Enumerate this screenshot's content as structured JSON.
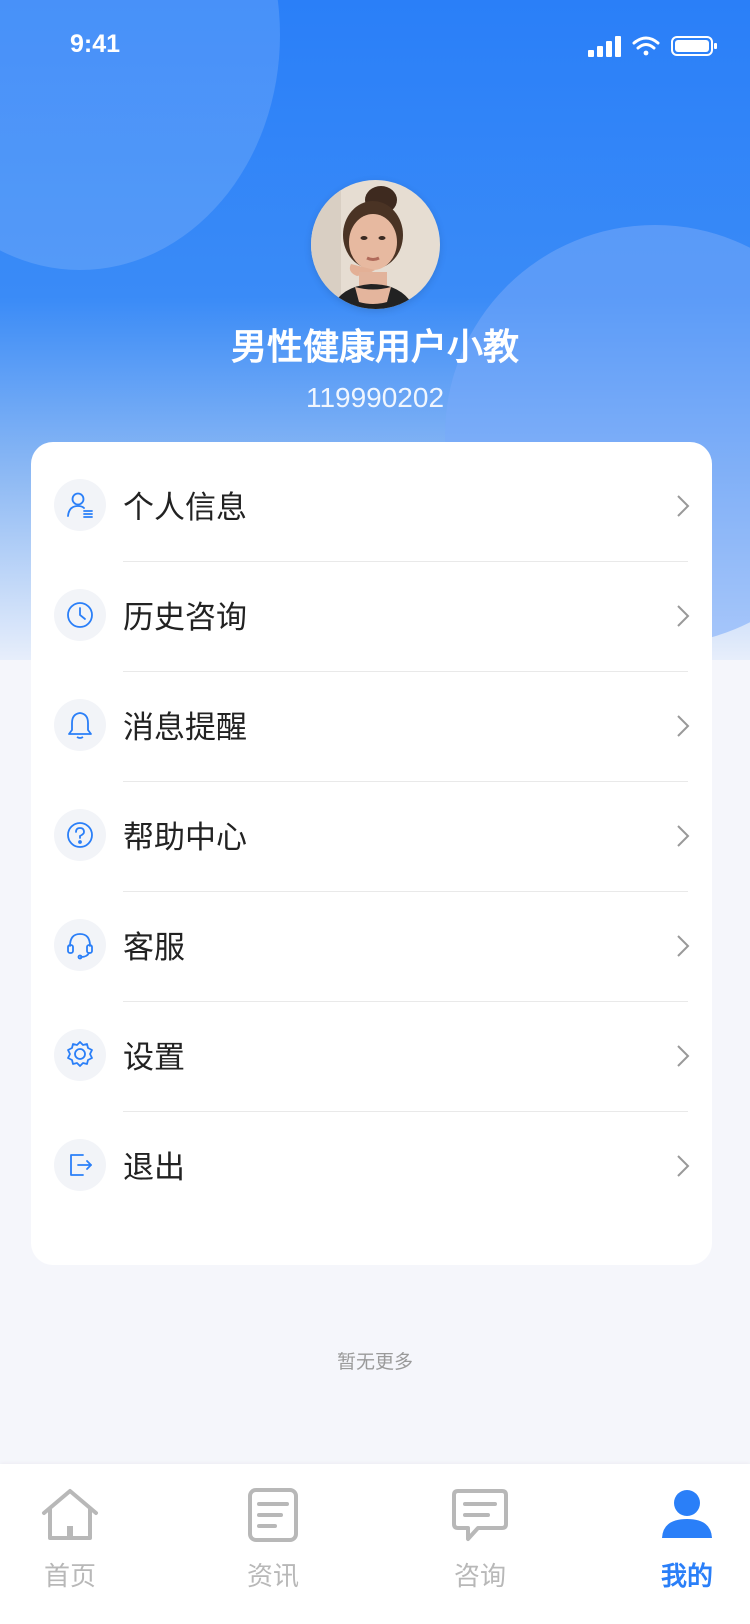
{
  "status_bar": {
    "time": "9:41"
  },
  "profile": {
    "name": "男性健康用户小教",
    "id": "119990202"
  },
  "menu": {
    "items": [
      {
        "label": "个人信息",
        "icon": "user-info-icon"
      },
      {
        "label": "历史咨询",
        "icon": "clock-icon"
      },
      {
        "label": "消息提醒",
        "icon": "bell-icon"
      },
      {
        "label": "帮助中心",
        "icon": "help-icon"
      },
      {
        "label": "客服",
        "icon": "headset-icon"
      },
      {
        "label": "设置",
        "icon": "gear-icon"
      },
      {
        "label": "退出",
        "icon": "logout-icon"
      }
    ]
  },
  "footer_note": "暂无更多",
  "tabbar": {
    "items": [
      {
        "label": "首页",
        "icon": "home-icon"
      },
      {
        "label": "资讯",
        "icon": "news-icon"
      },
      {
        "label": "咨询",
        "icon": "chat-icon"
      },
      {
        "label": "我的",
        "icon": "person-icon",
        "active": true
      }
    ]
  },
  "colors": {
    "accent": "#2a7ff8",
    "inactive": "#b8b8b8",
    "text": "#222222"
  }
}
